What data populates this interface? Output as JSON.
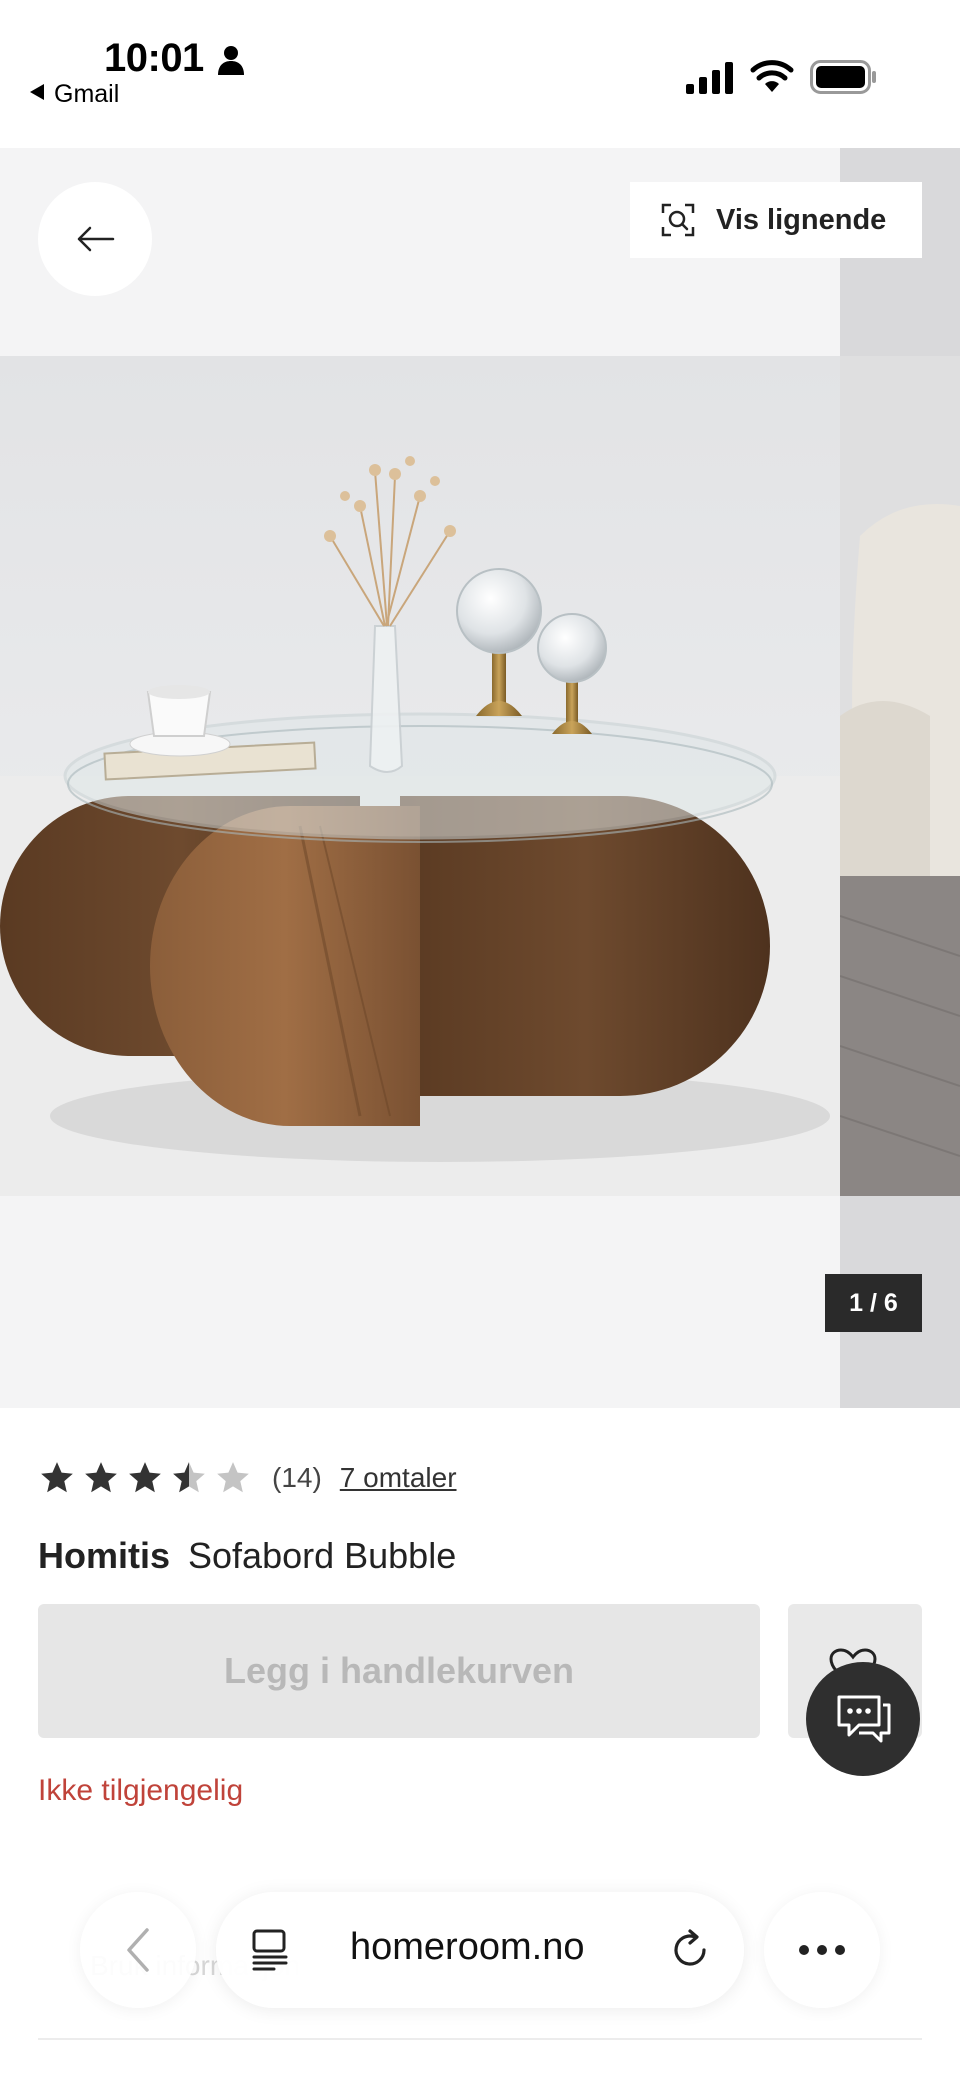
{
  "status_bar": {
    "time": "10:01",
    "back_app": "Gmail"
  },
  "gallery": {
    "similar_label": "Vis lignende",
    "pager": "1 / 6"
  },
  "product": {
    "rating": 3.5,
    "rating_max": 5,
    "review_count": "(14)",
    "reviews_link": "7 omtaler",
    "brand": "Homitis",
    "name": "Sofabord Bubble",
    "add_to_cart": "Legg i handlekurven",
    "availability": "Ikke tilgjengelig"
  },
  "faded_section": {
    "label": "Bruk informasjon"
  },
  "browser": {
    "url": "homeroom.no"
  },
  "colors": {
    "availability": "#c0433a",
    "pager_bg": "#2a2a2a",
    "chat_bg": "#2f2f2f",
    "button_disabled_bg": "#e6e6e6"
  },
  "icons": [
    "person-icon",
    "signal-icon",
    "wifi-icon",
    "battery-icon",
    "arrow-left-icon",
    "visual-search-icon",
    "star-icon",
    "heart-icon",
    "chat-icon",
    "chevron-left-icon",
    "reader-icon",
    "reload-icon",
    "more-icon"
  ]
}
